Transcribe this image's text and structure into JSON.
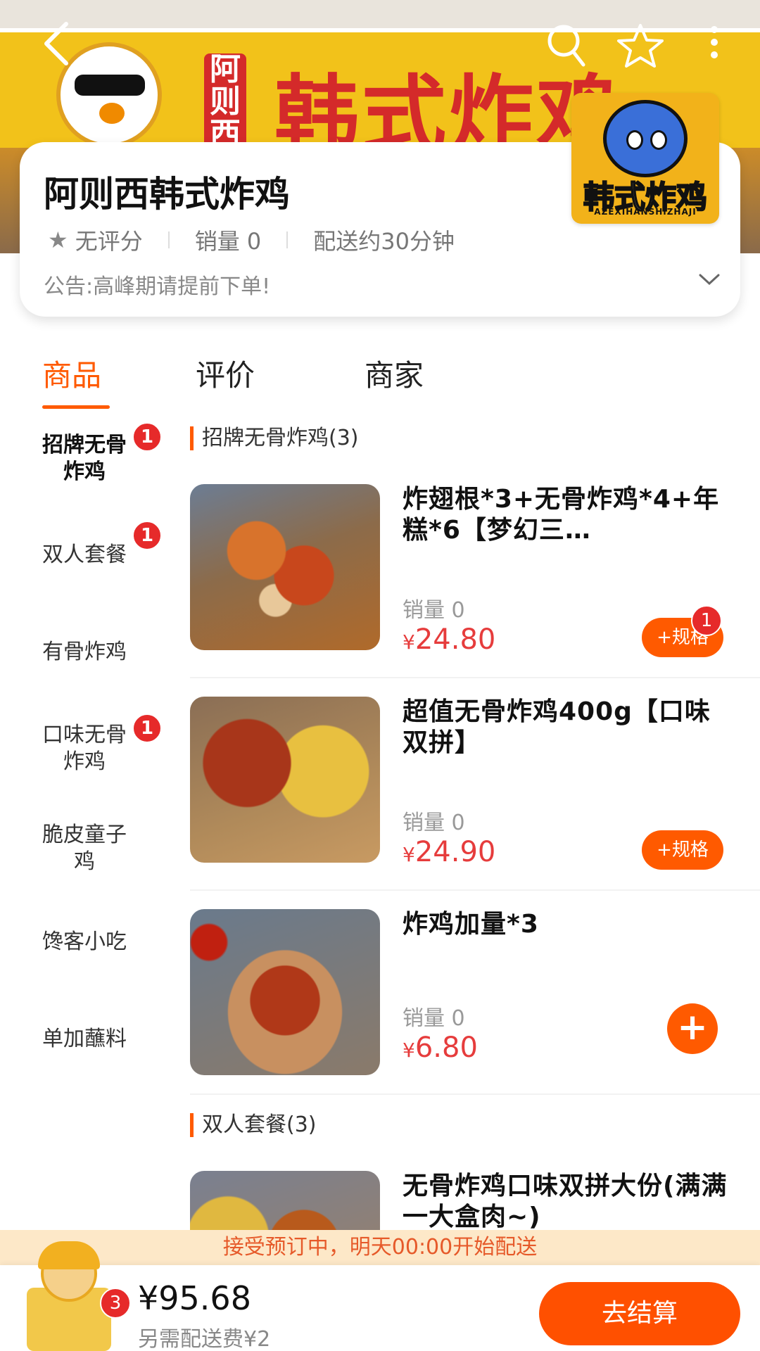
{
  "banner": {
    "sign_text": "韩式炸鸡",
    "sign_sub": "阿则西",
    "mascot_label": "韩式炸鸡"
  },
  "topbar": {
    "back_icon": "back-arrow-icon",
    "search_icon": "search-icon",
    "favorite_icon": "star-outline-icon",
    "more_icon": "more-vertical-icon"
  },
  "shop": {
    "name": "阿则西韩式炸鸡",
    "rating": "无评分",
    "sales": "销量 0",
    "delivery_time": "配送约30分钟",
    "notice": "公告:高峰期请提前下单!",
    "logo_text": "韩式炸鸡",
    "logo_sub": "AZEXIHANSHIZHAJI"
  },
  "tabs": [
    {
      "label": "商品",
      "active": true
    },
    {
      "label": "评价",
      "active": false
    },
    {
      "label": "商家",
      "active": false
    }
  ],
  "categories": [
    {
      "label": "招牌无骨\n炸鸡",
      "badge": "1",
      "active": true
    },
    {
      "label": "双人套餐",
      "badge": "1",
      "active": false
    },
    {
      "label": "有骨炸鸡",
      "badge": "",
      "active": false
    },
    {
      "label": "口味无骨\n炸鸡",
      "badge": "1",
      "active": false
    },
    {
      "label": "脆皮童子\n鸡",
      "badge": "",
      "active": false
    },
    {
      "label": "馋客小吃",
      "badge": "",
      "active": false
    },
    {
      "label": "单加蘸料",
      "badge": "",
      "active": false
    }
  ],
  "sections": [
    {
      "title": "招牌无骨炸鸡(3)"
    },
    {
      "title": "双人套餐(3)"
    }
  ],
  "products": [
    {
      "title": "炸翅根*3+无骨炸鸡*4+年糕*6【梦幻三…",
      "sales": "销量 0",
      "price": "24.80",
      "button": "+规格",
      "badge": "1"
    },
    {
      "title": "超值无骨炸鸡400g【口味双拼】",
      "sales": "销量 0",
      "price": "24.90",
      "button": "+规格",
      "badge": ""
    },
    {
      "title": "炸鸡加量*3",
      "sales": "销量 0",
      "price": "6.80",
      "button": "+",
      "badge": ""
    },
    {
      "title": "无骨炸鸡口味双拼大份(满满一大盒肉~)",
      "sales": "",
      "price": "",
      "button": "",
      "badge": ""
    }
  ],
  "currency": "¥",
  "preorder_notice": "接受预订中，明天00:00开始配送",
  "cart": {
    "count": "3",
    "total": "¥95.68",
    "delivery_fee": "另需配送费¥2",
    "checkout_label": "去结算"
  },
  "colors": {
    "accent": "#ff5a00",
    "price": "#e63c3c",
    "badge": "#e62a2a"
  }
}
